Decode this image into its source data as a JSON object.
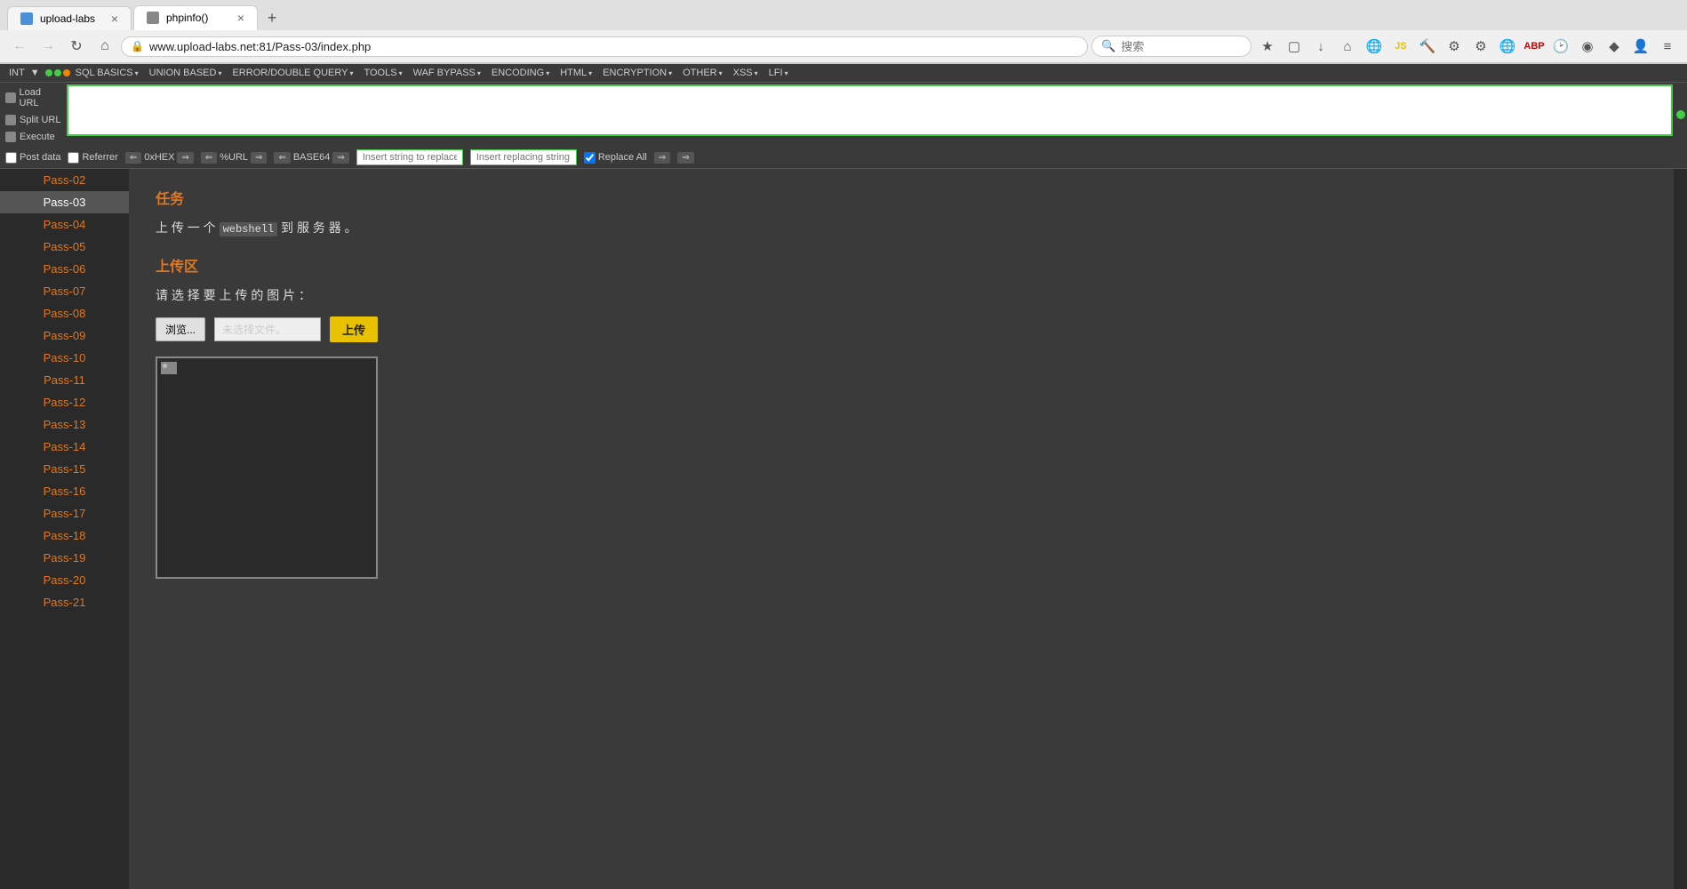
{
  "browser": {
    "tabs": [
      {
        "id": "tab1",
        "title": "upload-labs",
        "active": false,
        "favicon": "upload"
      },
      {
        "id": "tab2",
        "title": "phpinfo()",
        "active": true,
        "favicon": "php"
      }
    ],
    "url": "www.upload-labs.net:81/Pass-03/index.php",
    "search_placeholder": "搜索"
  },
  "ext_toolbar": {
    "int_label": "INT",
    "green_dots": 2,
    "orange_dot": 1,
    "menus": [
      "SQL BASICS▾",
      "UNION BASED▾",
      "ERROR/DOUBLE QUERY▾",
      "TOOLS▾",
      "WAF BYPASS▾",
      "ENCODING▾",
      "HTML▾",
      "ENCRYPTION▾",
      "OTHER▾",
      "XSS▾",
      "LFI▾"
    ]
  },
  "left_panel": {
    "buttons": [
      {
        "label": "Load URL",
        "icon": "load"
      },
      {
        "label": "Split URL",
        "icon": "split"
      },
      {
        "label": "Execute",
        "icon": "exec"
      }
    ]
  },
  "options_bar": {
    "post_data_label": "Post data",
    "referrer_label": "Referrer",
    "oxhex_label": "0xHEX",
    "url_label": "%URL",
    "base64_label": "BASE64",
    "replace_placeholder": "Insert string to replace",
    "replacing_placeholder": "Insert replacing string",
    "replace_all_label": "Replace All"
  },
  "sidebar": {
    "items": [
      {
        "id": "pass02",
        "label": "Pass-02"
      },
      {
        "id": "pass03",
        "label": "Pass-03",
        "active": true
      },
      {
        "id": "pass04",
        "label": "Pass-04"
      },
      {
        "id": "pass05",
        "label": "Pass-05"
      },
      {
        "id": "pass06",
        "label": "Pass-06"
      },
      {
        "id": "pass07",
        "label": "Pass-07"
      },
      {
        "id": "pass08",
        "label": "Pass-08"
      },
      {
        "id": "pass09",
        "label": "Pass-09"
      },
      {
        "id": "pass10",
        "label": "Pass-10"
      },
      {
        "id": "pass11",
        "label": "Pass-11"
      },
      {
        "id": "pass12",
        "label": "Pass-12"
      },
      {
        "id": "pass13",
        "label": "Pass-13"
      },
      {
        "id": "pass14",
        "label": "Pass-14"
      },
      {
        "id": "pass15",
        "label": "Pass-15"
      },
      {
        "id": "pass16",
        "label": "Pass-16"
      },
      {
        "id": "pass17",
        "label": "Pass-17"
      },
      {
        "id": "pass18",
        "label": "Pass-18"
      },
      {
        "id": "pass19",
        "label": "Pass-19"
      },
      {
        "id": "pass20",
        "label": "Pass-20"
      },
      {
        "id": "pass21",
        "label": "Pass-21"
      }
    ]
  },
  "content": {
    "task_title": "任务",
    "task_desc_part1": "上 传 一 个 ",
    "task_webshell": "webshell",
    "task_desc_part2": " 到 服 务 器 。",
    "upload_title": "上传区",
    "upload_desc": "请 选 择 要 上 传 的 图 片 ：",
    "browse_btn": "浏览...",
    "file_placeholder": "未选择文件。",
    "upload_btn": "上传"
  }
}
